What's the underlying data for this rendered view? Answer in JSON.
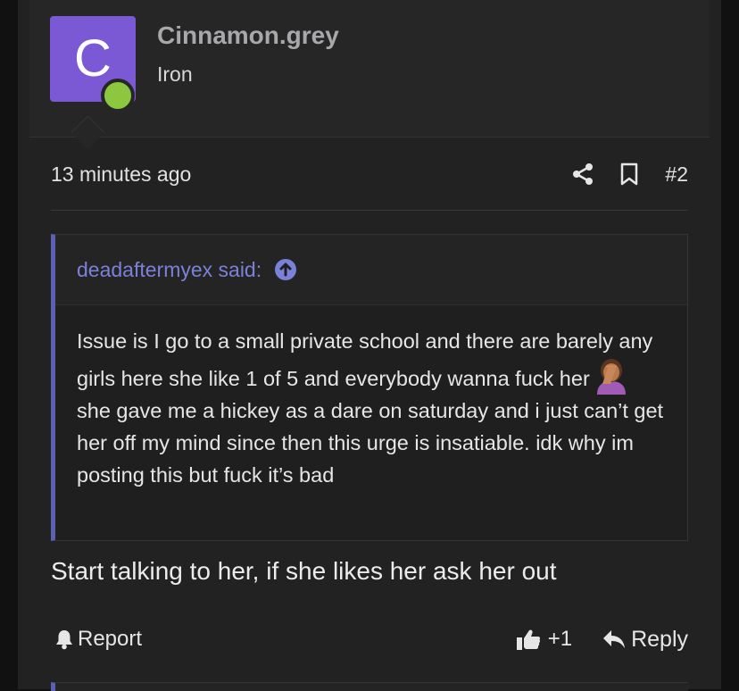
{
  "user": {
    "avatar_letter": "C",
    "username": "Cinnamon.grey",
    "title": "Iron",
    "avatar_color": "#7b59d4",
    "online_color": "#8dc63f"
  },
  "post": {
    "time": "13 minutes ago",
    "number": "#2",
    "icons": [
      "share-icon",
      "bookmark-icon"
    ]
  },
  "quote": {
    "author": "deadaftermyex said:",
    "text_before_emoji": "Issue is I go to a small private school and there are barely any girls here she like 1 of 5 and everybody wanna fuck her",
    "emoji": "woman-facepalming-emoji",
    "text_after_emoji": "she gave me a hickey as a dare on saturday and i just can’t get her off my mind since then this urge is insatiable. idk why im posting this but fuck it’s bad",
    "accent_color": "#5b60b4"
  },
  "body": {
    "text": "Start talking to her, if she likes her ask her out"
  },
  "actions": {
    "report_label": "Report",
    "like_count": "+1",
    "reply_label": "Reply"
  }
}
